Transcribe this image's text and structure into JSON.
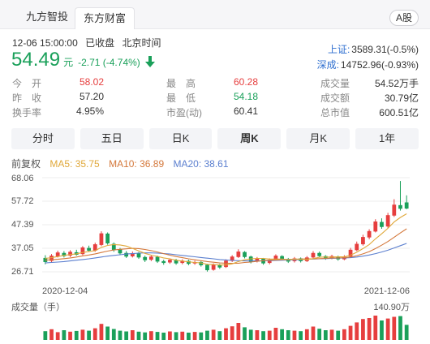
{
  "tabs": {
    "source1": "九方智投",
    "source2": "东方财富",
    "market": "A股"
  },
  "time": {
    "datetime": "12-06 15:00:00",
    "status": "已收盘",
    "zone": "北京时间"
  },
  "quote": {
    "price": "54.49",
    "unit": "元",
    "change": "-2.71 (-4.74%)"
  },
  "indices": [
    {
      "name": "上证:",
      "value": "3589.31(-0.5%)"
    },
    {
      "name": "深成:",
      "value": "14752.96(-0.93%)"
    }
  ],
  "stats": {
    "open_label": "今　开",
    "open": "58.02",
    "prev_label": "昨　收",
    "prev": "57.20",
    "turnover_label": "换手率",
    "turnover": "4.95%",
    "high_label": "最　高",
    "high": "60.28",
    "low_label": "最　低",
    "low": "54.18",
    "pe_label": "市盈(动)",
    "pe": "60.41",
    "vol_label": "成交量",
    "vol": "54.52万手",
    "amt_label": "成交额",
    "amt": "30.79亿",
    "cap_label": "总市值",
    "cap": "600.51亿"
  },
  "periods": [
    "分时",
    "五日",
    "日K",
    "周K",
    "月K",
    "1年"
  ],
  "active_period": "周K",
  "ma": {
    "adjust": "前复权",
    "ma5": "MA5: 35.75",
    "ma10": "MA10: 36.89",
    "ma20": "MA20: 38.61"
  },
  "colors": {
    "up": "#e63e3e",
    "down": "#1aa05a",
    "ma5": "#e0a83a",
    "ma10": "#d4783b",
    "ma20": "#5b7fcf",
    "link": "#2f6fd0"
  },
  "chart_data": {
    "type": "candlestick",
    "y_ticks": [
      "68.06",
      "57.72",
      "47.39",
      "37.05",
      "26.71"
    ],
    "ylim": [
      26.71,
      68.06
    ],
    "x_labels": [
      "2020-12-04",
      "2021-12-06"
    ],
    "volume_label": "成交量（手）",
    "volume_max_label": "140.90万",
    "candles": [
      {
        "o": 32.8,
        "c": 31.0,
        "h": 34.0,
        "l": 30.0
      },
      {
        "o": 31.5,
        "c": 33.8,
        "h": 34.5,
        "l": 31.0
      },
      {
        "o": 33.5,
        "c": 35.2,
        "h": 36.0,
        "l": 33.0
      },
      {
        "o": 35.0,
        "c": 33.6,
        "h": 35.8,
        "l": 33.0
      },
      {
        "o": 33.8,
        "c": 35.5,
        "h": 36.2,
        "l": 33.2
      },
      {
        "o": 35.3,
        "c": 34.2,
        "h": 36.4,
        "l": 33.8
      },
      {
        "o": 34.5,
        "c": 37.4,
        "h": 38.0,
        "l": 34.0
      },
      {
        "o": 37.2,
        "c": 36.0,
        "h": 38.2,
        "l": 35.6
      },
      {
        "o": 36.0,
        "c": 38.8,
        "h": 39.5,
        "l": 35.5
      },
      {
        "o": 38.5,
        "c": 43.6,
        "h": 44.5,
        "l": 38.0
      },
      {
        "o": 43.5,
        "c": 39.2,
        "h": 44.0,
        "l": 38.6
      },
      {
        "o": 39.0,
        "c": 36.2,
        "h": 39.6,
        "l": 35.5
      },
      {
        "o": 36.5,
        "c": 34.8,
        "h": 37.2,
        "l": 34.0
      },
      {
        "o": 35.0,
        "c": 33.4,
        "h": 35.8,
        "l": 32.8
      },
      {
        "o": 33.5,
        "c": 34.9,
        "h": 35.6,
        "l": 33.0
      },
      {
        "o": 35.0,
        "c": 33.0,
        "h": 35.4,
        "l": 32.4
      },
      {
        "o": 33.2,
        "c": 31.8,
        "h": 33.8,
        "l": 31.0
      },
      {
        "o": 32.0,
        "c": 33.4,
        "h": 34.0,
        "l": 31.4
      },
      {
        "o": 33.3,
        "c": 31.2,
        "h": 33.8,
        "l": 30.6
      },
      {
        "o": 31.4,
        "c": 30.6,
        "h": 32.0,
        "l": 29.8
      },
      {
        "o": 30.8,
        "c": 32.0,
        "h": 32.6,
        "l": 30.2
      },
      {
        "o": 31.8,
        "c": 30.4,
        "h": 32.4,
        "l": 29.8
      },
      {
        "o": 30.6,
        "c": 31.6,
        "h": 32.2,
        "l": 30.0
      },
      {
        "o": 31.5,
        "c": 30.2,
        "h": 32.0,
        "l": 29.6
      },
      {
        "o": 30.4,
        "c": 31.0,
        "h": 31.6,
        "l": 29.8
      },
      {
        "o": 31.0,
        "c": 29.6,
        "h": 31.4,
        "l": 29.0
      },
      {
        "o": 29.8,
        "c": 27.4,
        "h": 30.2,
        "l": 26.8
      },
      {
        "o": 27.6,
        "c": 29.8,
        "h": 30.4,
        "l": 27.2
      },
      {
        "o": 29.8,
        "c": 28.6,
        "h": 30.2,
        "l": 28.0
      },
      {
        "o": 28.8,
        "c": 31.6,
        "h": 32.2,
        "l": 28.4
      },
      {
        "o": 31.5,
        "c": 33.4,
        "h": 34.0,
        "l": 31.0
      },
      {
        "o": 33.2,
        "c": 35.6,
        "h": 36.6,
        "l": 32.8
      },
      {
        "o": 35.4,
        "c": 33.2,
        "h": 35.8,
        "l": 32.6
      },
      {
        "o": 33.4,
        "c": 31.0,
        "h": 33.8,
        "l": 30.4
      },
      {
        "o": 31.2,
        "c": 32.6,
        "h": 33.2,
        "l": 30.8
      },
      {
        "o": 32.4,
        "c": 30.4,
        "h": 32.8,
        "l": 29.8
      },
      {
        "o": 30.6,
        "c": 32.0,
        "h": 32.6,
        "l": 30.0
      },
      {
        "o": 32.0,
        "c": 33.8,
        "h": 34.4,
        "l": 31.6
      },
      {
        "o": 33.6,
        "c": 32.4,
        "h": 34.0,
        "l": 31.8
      },
      {
        "o": 32.4,
        "c": 31.2,
        "h": 32.8,
        "l": 30.6
      },
      {
        "o": 31.4,
        "c": 32.6,
        "h": 33.2,
        "l": 30.8
      },
      {
        "o": 32.6,
        "c": 31.4,
        "h": 33.0,
        "l": 30.8
      },
      {
        "o": 31.4,
        "c": 33.0,
        "h": 33.6,
        "l": 31.0
      },
      {
        "o": 33.0,
        "c": 35.0,
        "h": 35.8,
        "l": 32.6
      },
      {
        "o": 35.0,
        "c": 33.6,
        "h": 35.6,
        "l": 33.0
      },
      {
        "o": 33.6,
        "c": 32.4,
        "h": 34.0,
        "l": 32.0
      },
      {
        "o": 32.6,
        "c": 33.6,
        "h": 34.2,
        "l": 32.2
      },
      {
        "o": 33.4,
        "c": 32.2,
        "h": 33.8,
        "l": 31.6
      },
      {
        "o": 32.2,
        "c": 33.4,
        "h": 34.0,
        "l": 31.8
      },
      {
        "o": 33.4,
        "c": 36.4,
        "h": 37.2,
        "l": 33.0
      },
      {
        "o": 36.2,
        "c": 39.0,
        "h": 40.0,
        "l": 35.8
      },
      {
        "o": 38.8,
        "c": 42.0,
        "h": 43.0,
        "l": 38.2
      },
      {
        "o": 41.8,
        "c": 44.6,
        "h": 45.4,
        "l": 41.0
      },
      {
        "o": 44.4,
        "c": 48.8,
        "h": 49.8,
        "l": 44.0
      },
      {
        "o": 48.6,
        "c": 46.4,
        "h": 50.2,
        "l": 45.6
      },
      {
        "o": 46.6,
        "c": 51.6,
        "h": 52.6,
        "l": 46.0
      },
      {
        "o": 51.4,
        "c": 56.2,
        "h": 58.6,
        "l": 50.8
      },
      {
        "o": 56.0,
        "c": 54.4,
        "h": 66.6,
        "l": 53.6
      },
      {
        "o": 57.2,
        "c": 54.5,
        "h": 60.3,
        "l": 54.2
      }
    ],
    "ma5": [
      32.6,
      32.9,
      33.4,
      33.9,
      34.3,
      34.6,
      35.2,
      35.6,
      36.0,
      37.4,
      38.3,
      38.7,
      38.5,
      38.0,
      37.0,
      35.9,
      34.8,
      34.0,
      33.5,
      32.8,
      32.4,
      31.8,
      31.4,
      31.1,
      30.8,
      30.6,
      30.0,
      29.9,
      29.7,
      29.7,
      30.2,
      31.2,
      32.0,
      32.4,
      32.6,
      32.6,
      32.3,
      32.3,
      32.3,
      32.1,
      32.3,
      32.2,
      32.1,
      32.5,
      33.1,
      33.2,
      33.2,
      33.3,
      33.3,
      34.0,
      35.3,
      36.9,
      38.7,
      41.2,
      43.4,
      45.8,
      48.6,
      50.6,
      52.2
    ],
    "ma10": [
      31.8,
      32.0,
      32.2,
      32.5,
      32.8,
      33.2,
      33.7,
      34.1,
      34.6,
      35.2,
      35.8,
      36.3,
      36.6,
      36.8,
      37.0,
      36.9,
      36.5,
      36.0,
      35.4,
      34.7,
      34.0,
      33.4,
      32.9,
      32.4,
      32.0,
      31.6,
      31.2,
      30.9,
      30.6,
      30.5,
      30.4,
      30.5,
      30.8,
      31.0,
      31.3,
      31.6,
      31.8,
      31.9,
      32.1,
      32.1,
      32.2,
      32.3,
      32.4,
      32.4,
      32.5,
      32.6,
      32.8,
      32.8,
      32.9,
      33.2,
      33.8,
      34.6,
      35.6,
      36.9,
      38.4,
      40.0,
      41.9,
      43.8,
      45.6
    ],
    "ma20": [
      30.6,
      30.8,
      31.0,
      31.2,
      31.5,
      31.8,
      32.1,
      32.4,
      32.8,
      33.2,
      33.6,
      33.9,
      34.2,
      34.5,
      34.7,
      34.9,
      35.0,
      35.0,
      34.9,
      34.7,
      34.5,
      34.2,
      33.9,
      33.6,
      33.3,
      33.0,
      32.7,
      32.4,
      32.1,
      31.9,
      31.7,
      31.6,
      31.5,
      31.5,
      31.5,
      31.6,
      31.6,
      31.7,
      31.8,
      31.9,
      32.0,
      32.1,
      32.2,
      32.3,
      32.4,
      32.5,
      32.6,
      32.7,
      32.8,
      32.9,
      33.2,
      33.6,
      34.1,
      34.7,
      35.4,
      36.2,
      37.2,
      38.2,
      39.2
    ],
    "volume": [
      0.36,
      0.44,
      0.32,
      0.4,
      0.34,
      0.37,
      0.42,
      0.38,
      0.48,
      0.66,
      0.55,
      0.45,
      0.38,
      0.35,
      0.4,
      0.34,
      0.31,
      0.36,
      0.33,
      0.3,
      0.35,
      0.32,
      0.34,
      0.3,
      0.33,
      0.31,
      0.38,
      0.42,
      0.36,
      0.48,
      0.56,
      0.7,
      0.52,
      0.42,
      0.4,
      0.36,
      0.38,
      0.5,
      0.44,
      0.4,
      0.38,
      0.36,
      0.44,
      0.55,
      0.46,
      0.4,
      0.42,
      0.38,
      0.44,
      0.58,
      0.72,
      0.86,
      0.9,
      1.0,
      0.8,
      0.88,
      0.95,
      0.98,
      0.62
    ]
  }
}
